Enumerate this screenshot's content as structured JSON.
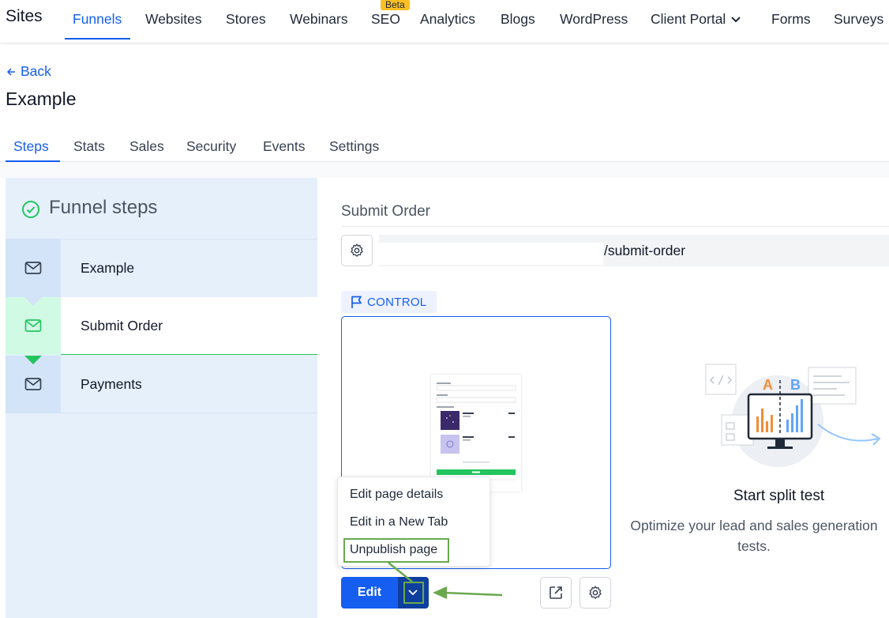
{
  "nav": {
    "brand": "Sites",
    "items": [
      "Funnels",
      "Websites",
      "Stores",
      "Webinars",
      "SEO",
      "Analytics",
      "Blogs",
      "WordPress",
      "Client Portal",
      "Forms",
      "Surveys"
    ],
    "active": "Funnels",
    "seo_badge": "Beta"
  },
  "header": {
    "back_label": "Back",
    "title": "Example"
  },
  "subtabs": {
    "items": [
      "Steps",
      "Stats",
      "Sales",
      "Security",
      "Events",
      "Settings"
    ],
    "active": "Steps"
  },
  "funnel": {
    "heading": "Funnel steps",
    "steps": [
      "Example",
      "Submit Order",
      "Payments"
    ],
    "selected": "Submit Order"
  },
  "step_detail": {
    "title": "Submit Order",
    "path": "/submit-order",
    "variant_label": "CONTROL"
  },
  "menu": {
    "items": [
      "Edit page details",
      "Edit in a New Tab",
      "Unpublish page"
    ],
    "highlighted": "Unpublish page"
  },
  "actions": {
    "edit_label": "Edit"
  },
  "split_test": {
    "title": "Start split test",
    "description": "Optimize your lead and sales generation tests.",
    "ab_labels": [
      "A",
      "B"
    ]
  },
  "colors": {
    "accent": "#155eef",
    "success": "#22c55e",
    "annotation": "#6aa84f",
    "badge": "#fbbf24"
  }
}
